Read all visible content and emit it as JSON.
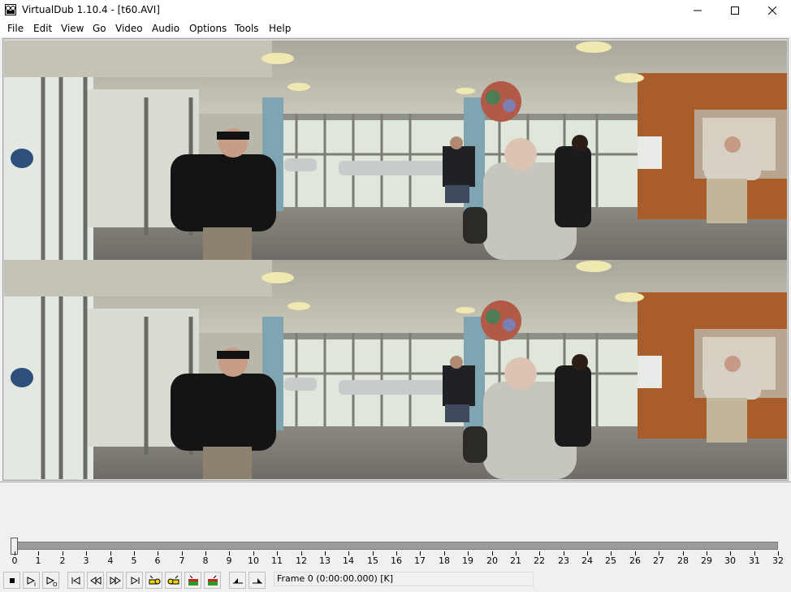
{
  "window": {
    "title": "VirtualDub 1.10.4 - [t60.AVI]"
  },
  "menu": [
    "File",
    "Edit",
    "View",
    "Go",
    "Video",
    "Audio",
    "Options",
    "Tools",
    "Help"
  ],
  "timeline": {
    "ticks": [
      "0",
      "1",
      "2",
      "3",
      "4",
      "5",
      "6",
      "7",
      "8",
      "9",
      "10",
      "11",
      "12",
      "13",
      "14",
      "15",
      "16",
      "17",
      "18",
      "19",
      "20",
      "21",
      "22",
      "23",
      "24",
      "25",
      "26",
      "27",
      "28",
      "29",
      "30",
      "31",
      "32"
    ],
    "position": 0
  },
  "toolbar": {
    "buttons": [
      "stop-icon",
      "play-input-icon",
      "play-output-icon",
      "go-start-icon",
      "step-back-icon",
      "step-forward-icon",
      "go-end-icon",
      "prev-key-icon",
      "next-key-icon",
      "scene-back-icon",
      "scene-forward-icon",
      "mark-in-icon",
      "mark-out-icon"
    ]
  },
  "status": {
    "frame_text": "Frame 0 (0:00:00.000) [K]"
  }
}
